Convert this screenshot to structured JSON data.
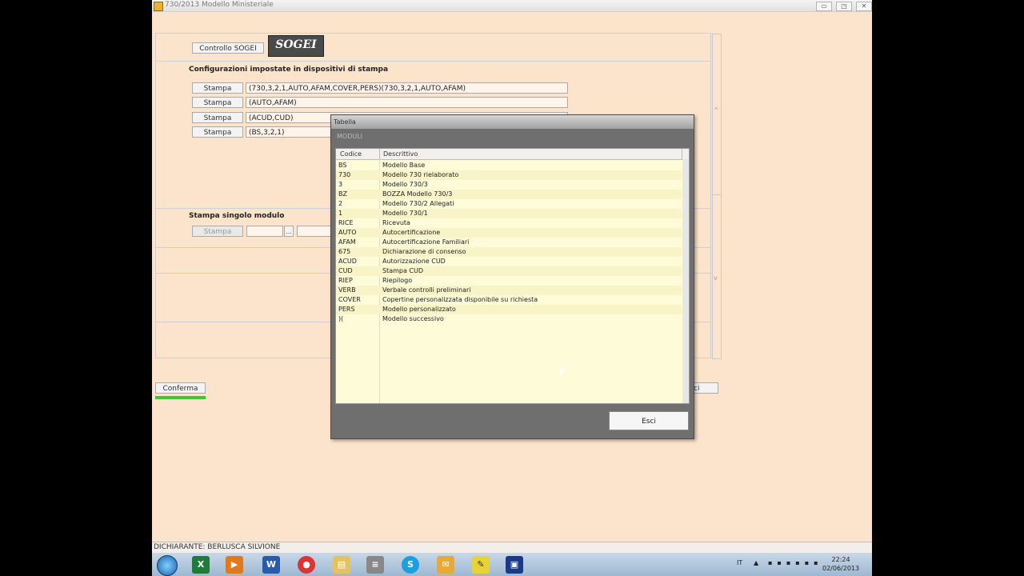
{
  "window": {
    "title": "730/2013 Modello Ministeriale",
    "controls": [
      "▭",
      "◳",
      "✕"
    ]
  },
  "top_panel": {
    "controllo_button": "Controllo SOGEI",
    "logo_text": "SOGEI"
  },
  "config": {
    "heading": "Configurazioni impostate in dispositivi di stampa",
    "rows": [
      {
        "button": "Stampa",
        "value": "(730,3,2,1,AUTO,AFAM,COVER,PERS)(730,3,2,1,AUTO,AFAM)"
      },
      {
        "button": "Stampa",
        "value": "(AUTO,AFAM)"
      },
      {
        "button": "Stampa",
        "value": "(ACUD,CUD)"
      },
      {
        "button": "Stampa",
        "value": "(BS,3,2,1)"
      }
    ]
  },
  "single": {
    "heading": "Stampa singolo modulo",
    "button": "Stampa",
    "ellipsis": "..."
  },
  "conferma": {
    "label": "Conferma",
    "progress": 1.0
  },
  "hidden_button_fragment": "ci",
  "dialog": {
    "title": "Tabella",
    "subtitle": "MODULI",
    "columns": [
      "Codice",
      "Descrittivo"
    ],
    "rows": [
      {
        "code": "BS",
        "desc": "Modello Base"
      },
      {
        "code": "730",
        "desc": "Modello 730 rielaborato"
      },
      {
        "code": "3",
        "desc": "Modello 730/3"
      },
      {
        "code": "BZ",
        "desc": "BOZZA Modello 730/3"
      },
      {
        "code": "2",
        "desc": "Modello 730/2 Allegati"
      },
      {
        "code": "1",
        "desc": "Modello 730/1"
      },
      {
        "code": "RICE",
        "desc": "Ricevuta"
      },
      {
        "code": "AUTO",
        "desc": "Autocertificazione"
      },
      {
        "code": "AFAM",
        "desc": "Autocertificazione Familiari"
      },
      {
        "code": "675",
        "desc": "Dichiarazione di consenso"
      },
      {
        "code": "ACUD",
        "desc": "Autorizzazione CUD"
      },
      {
        "code": "CUD",
        "desc": "Stampa CUD"
      },
      {
        "code": "RIEP",
        "desc": "Riepilogo"
      },
      {
        "code": "VERB",
        "desc": "Verbale controlli preliminari"
      },
      {
        "code": "COVER",
        "desc": "Copertine personalizzata disponibile su richiesta"
      },
      {
        "code": "PERS",
        "desc": "Modello personalizzato"
      },
      {
        "code": ")(",
        "desc": "Modello successivo"
      }
    ],
    "close_button": "Esci"
  },
  "status_bar": {
    "text": "DICHIARANTE: BERLUSCA SILVIONE"
  },
  "taskbar": {
    "icons": [
      "windows-start",
      "excel",
      "media-player",
      "word",
      "chrome",
      "file-explorer",
      "notepad",
      "skype",
      "outlook",
      "sticky-app",
      "app-window"
    ],
    "tray_lang": "IT",
    "time": "22:24",
    "date": "02/06/2013"
  }
}
